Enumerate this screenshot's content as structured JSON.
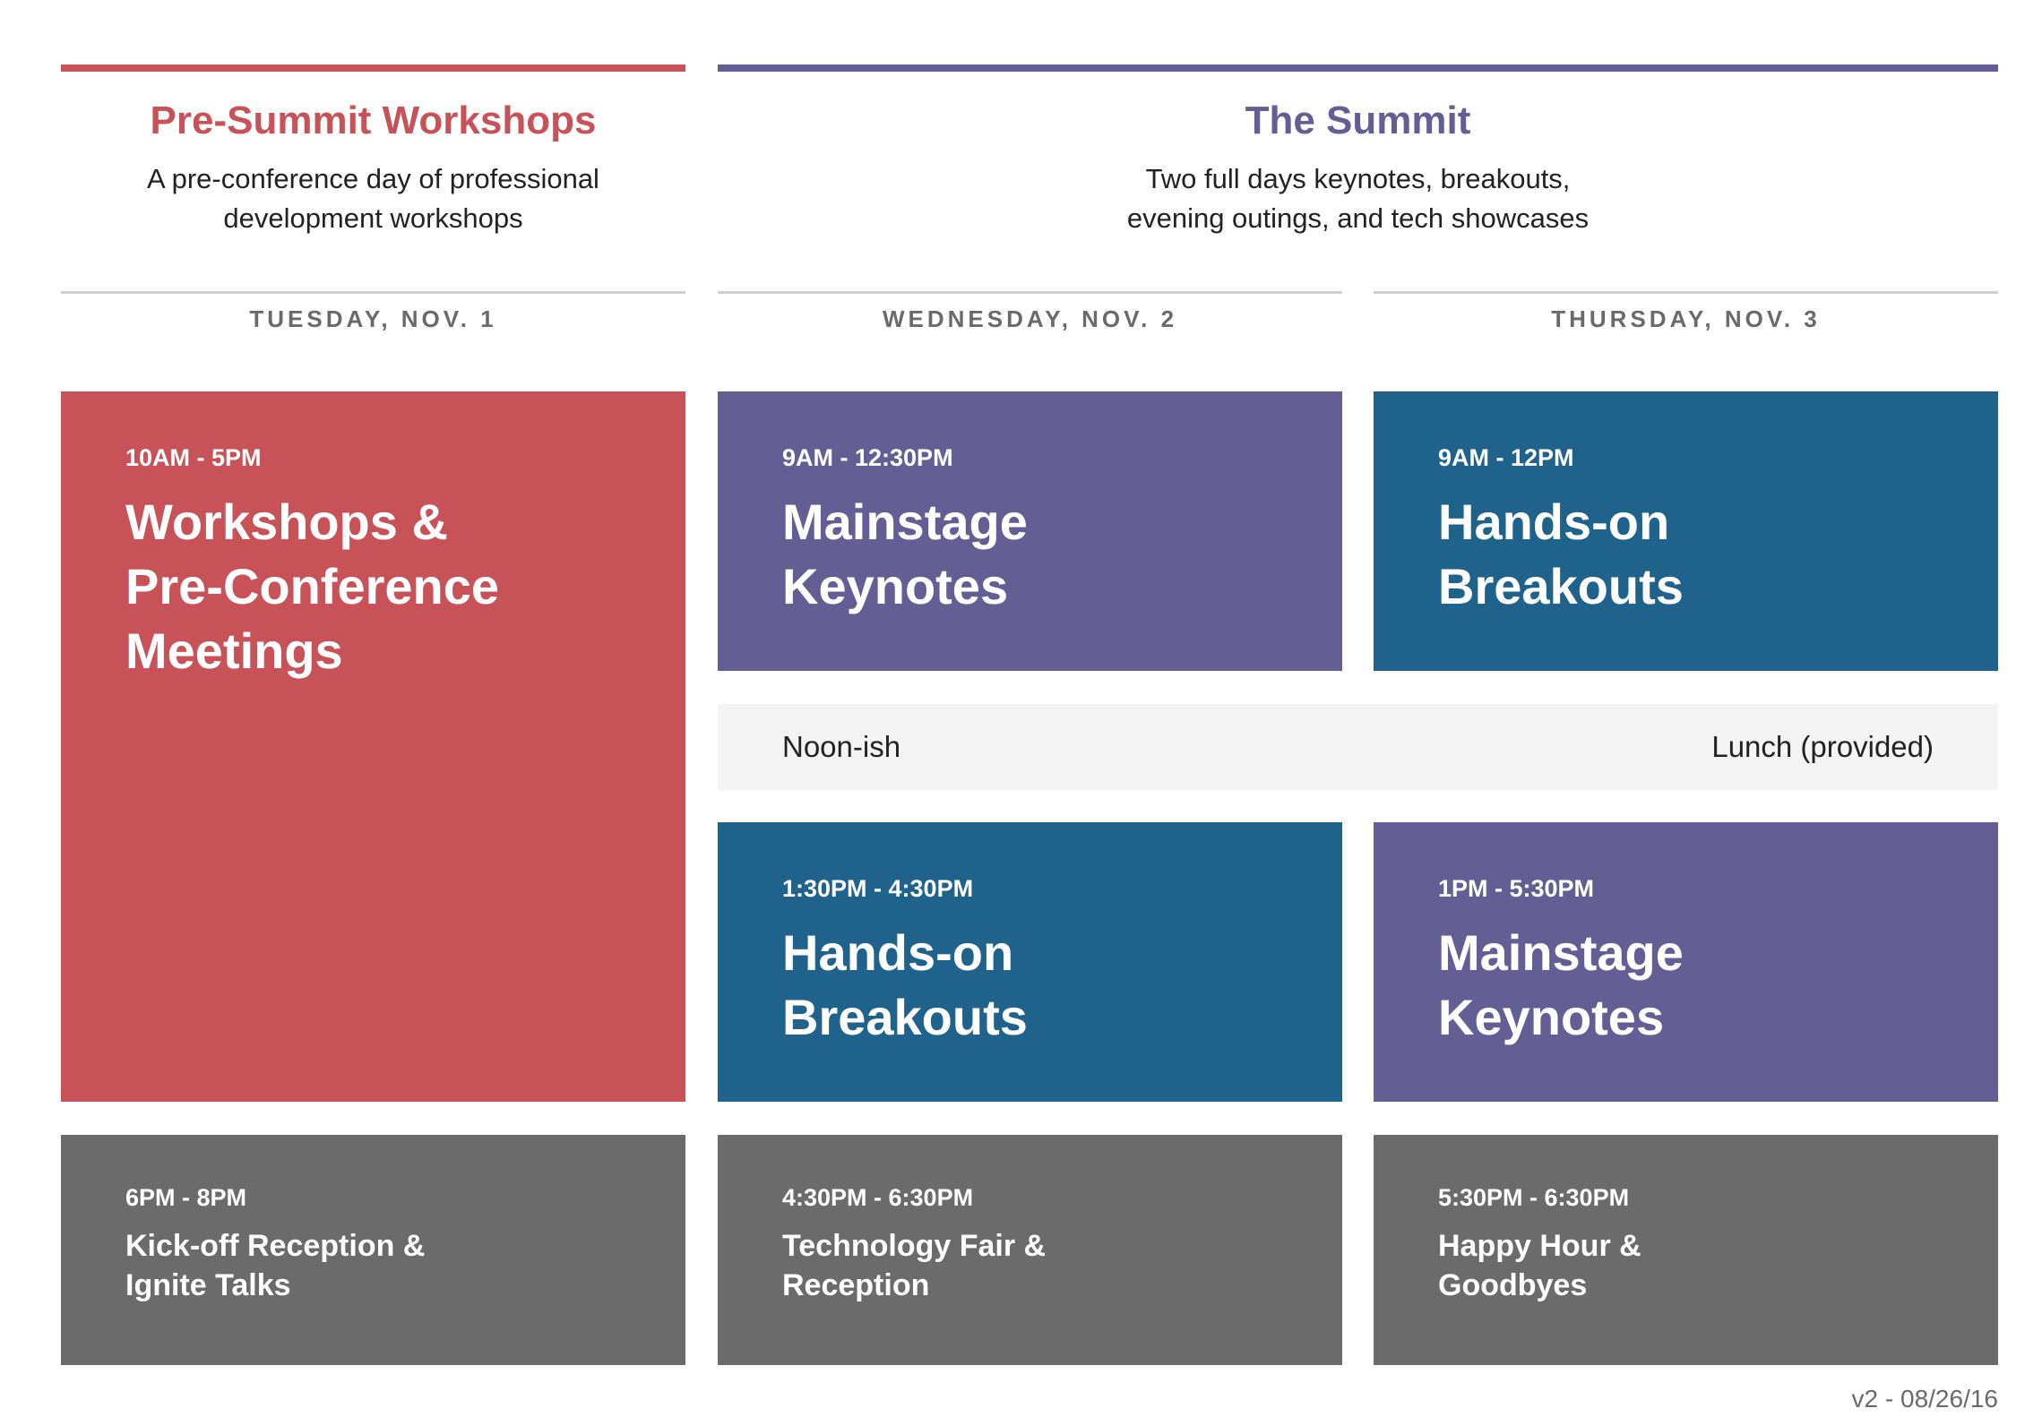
{
  "colors": {
    "pre_summit": "#c75258",
    "summit": "#635f94",
    "breakout_blue": "#1f628c",
    "evening_gray": "#6b6b6b",
    "lunch_bg": "#f4f4f4"
  },
  "sections": {
    "pre_summit": {
      "title": "Pre-Summit Workshops",
      "subtitle_line1": "A pre-conference day of professional",
      "subtitle_line2": "development workshops"
    },
    "summit": {
      "title": "The Summit",
      "subtitle_line1": "Two full days keynotes, breakouts,",
      "subtitle_line2": "evening outings, and tech showcases"
    }
  },
  "days": [
    {
      "label": "TUESDAY, NOV. 1",
      "main": {
        "time": "10AM - 5PM",
        "title_lines": [
          "Workshops &",
          "Pre-Conference",
          "Meetings"
        ]
      },
      "evening": {
        "time": "6PM - 8PM",
        "title_lines": [
          "Kick-off Reception &",
          "Ignite Talks"
        ]
      }
    },
    {
      "label": "WEDNESDAY, NOV. 2",
      "morning": {
        "time": "9AM - 12:30PM",
        "title_lines": [
          "Mainstage",
          "Keynotes"
        ]
      },
      "afternoon": {
        "time": "1:30PM - 4:30PM",
        "title_lines": [
          "Hands-on",
          "Breakouts"
        ]
      },
      "evening": {
        "time": "4:30PM - 6:30PM",
        "title_lines": [
          "Technology Fair &",
          "Reception"
        ]
      }
    },
    {
      "label": "THURSDAY, NOV. 3",
      "morning": {
        "time": "9AM - 12PM",
        "title_lines": [
          "Hands-on",
          "Breakouts"
        ]
      },
      "afternoon": {
        "time": "1PM - 5:30PM",
        "title_lines": [
          "Mainstage",
          "Keynotes"
        ]
      },
      "evening": {
        "time": "5:30PM - 6:30PM",
        "title_lines": [
          "Happy Hour &",
          "Goodbyes"
        ]
      }
    }
  ],
  "lunch": {
    "left": "Noon-ish",
    "right": "Lunch (provided)"
  },
  "version": "v2 - 08/26/16"
}
